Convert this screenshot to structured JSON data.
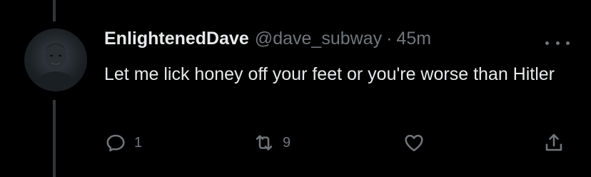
{
  "tweet": {
    "display_name": "EnlightenedDave",
    "handle": "@dave_subway",
    "separator": "·",
    "time": "45m",
    "text": "Let me lick honey off your feet or you're worse than Hitler",
    "reply_count": "1",
    "retweet_count": "9",
    "like_count": ""
  },
  "icons": {
    "more": "more-horizontal-icon",
    "reply": "reply-bubble-icon",
    "retweet": "retweet-icon",
    "like": "heart-icon",
    "share": "share-icon"
  },
  "colors": {
    "background": "#000000",
    "primary_text": "#e7e9ea",
    "secondary_text": "#71767b",
    "thread_line": "#333639"
  }
}
